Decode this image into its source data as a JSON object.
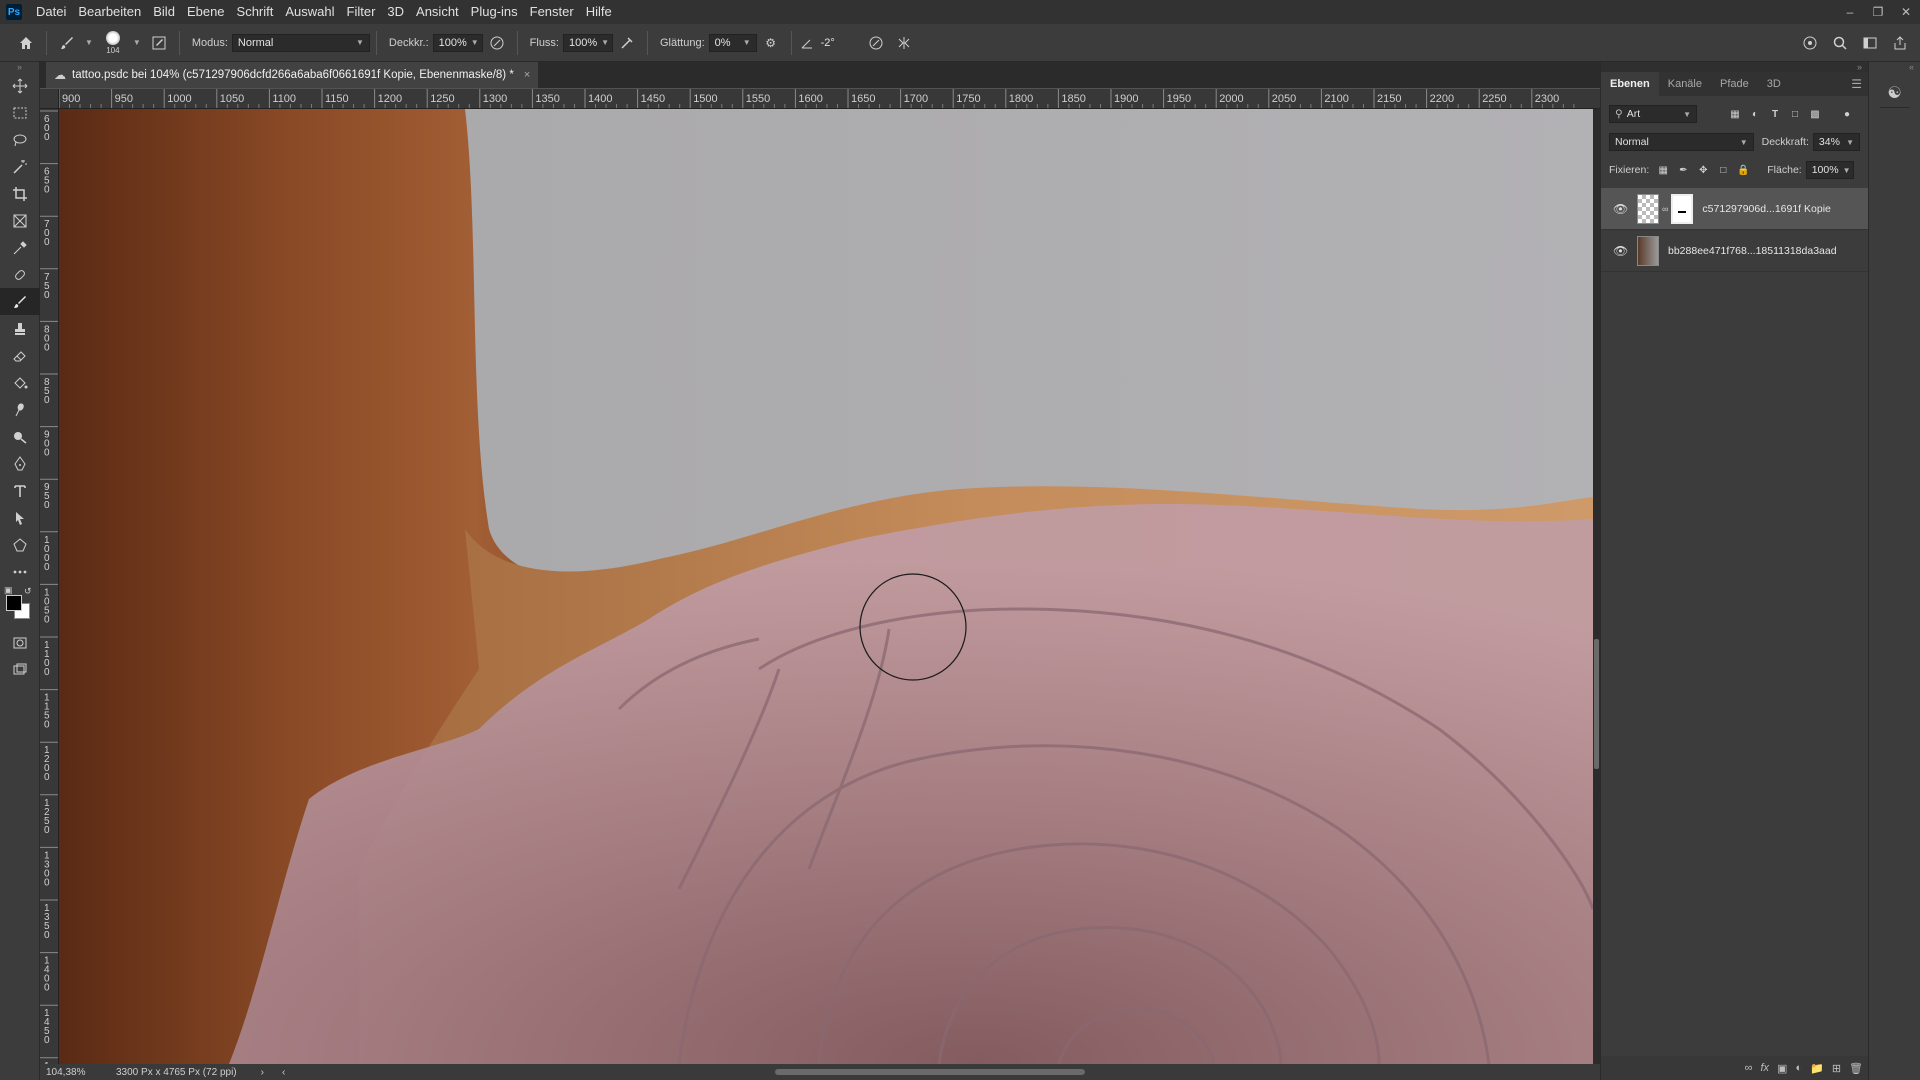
{
  "app": {
    "logo": "Ps"
  },
  "menu": [
    "Datei",
    "Bearbeiten",
    "Bild",
    "Ebene",
    "Schrift",
    "Auswahl",
    "Filter",
    "3D",
    "Ansicht",
    "Plug-ins",
    "Fenster",
    "Hilfe"
  ],
  "options": {
    "brush_size": "104",
    "mode_label": "Modus:",
    "mode_value": "Normal",
    "opacity_label": "Deckkr.:",
    "opacity_value": "100%",
    "flow_label": "Fluss:",
    "flow_value": "100%",
    "smoothing_label": "Glättung:",
    "smoothing_value": "0%",
    "angle_value": "-2°"
  },
  "document": {
    "tab_title": "tattoo.psdc bei 104% (c571297906dcfd266a6aba6f0661691f Kopie, Ebenenmaske/8) *",
    "close": "×"
  },
  "ruler_top_ticks": [
    "900",
    "950",
    "1000",
    "1050",
    "1100",
    "1150",
    "1200",
    "1250",
    "1300",
    "1350",
    "1400",
    "1450",
    "1500",
    "1550",
    "1600",
    "1650",
    "1700",
    "1750",
    "1800",
    "1850",
    "1900",
    "1950",
    "2000",
    "2050",
    "2100",
    "2150",
    "2200",
    "2250",
    "2300"
  ],
  "ruler_left_ticks": [
    "600",
    "650",
    "700",
    "750",
    "800",
    "850",
    "900",
    "950",
    "1000",
    "1050",
    "1100",
    "1150",
    "1200",
    "1250",
    "1300",
    "1350",
    "1400",
    "1450",
    "1500"
  ],
  "status": {
    "zoom": "104,38%",
    "doc_info": "3300 Px x 4765 Px (72 ppi)"
  },
  "panels": {
    "tabs": [
      "Ebenen",
      "Kanäle",
      "Pfade",
      "3D"
    ],
    "active_tab": "Ebenen",
    "filter_value": "Art",
    "blend_mode": "Normal",
    "opacity_label": "Deckkraft:",
    "opacity_value": "34%",
    "lock_label": "Fixieren:",
    "fill_label": "Fläche:",
    "fill_value": "100%",
    "layers": [
      {
        "name": "c571297906d...1691f Kopie",
        "visible": true,
        "selected": true,
        "has_mask": true
      },
      {
        "name": "bb288ee471f768...18511318da3aad",
        "visible": true,
        "selected": false,
        "has_mask": false
      }
    ]
  },
  "colors": {
    "foreground": "#000000",
    "background": "#ffffff",
    "accent": "#31a8ff"
  }
}
